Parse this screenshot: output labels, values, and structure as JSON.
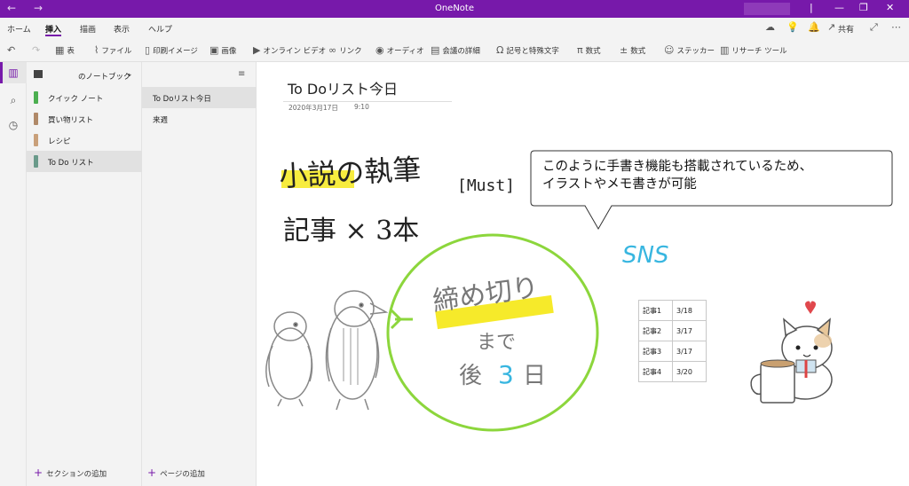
{
  "window": {
    "title": "OneNote",
    "back_icon": "arrow-left-icon",
    "forward_icon": "arrow-right-icon"
  },
  "menu": {
    "tabs": [
      "ホーム",
      "挿入",
      "描画",
      "表示",
      "ヘルプ"
    ],
    "active_tab": "挿入",
    "share_label": "共有"
  },
  "ribbon": {
    "items": [
      "表",
      "ファイル",
      "印刷イメージ",
      "画像",
      "オンライン ビデオ",
      "リンク",
      "オーディオ",
      "会議の詳細",
      "記号と特殊文字",
      "数式",
      "数式",
      "ステッカー",
      "リサーチ ツール"
    ]
  },
  "notebook": {
    "name": "のノートブック"
  },
  "sections": [
    {
      "label": "クイック ノート",
      "color": "#4caf50"
    },
    {
      "label": "買い物リスト",
      "color": "#b08968"
    },
    {
      "label": "レシピ",
      "color": "#c9a07a"
    },
    {
      "label": "To Do リスト",
      "color": "#6a9a8a"
    }
  ],
  "selected_section": "To Do リスト",
  "add_section_label": "セクションの追加",
  "pages": [
    {
      "label": "To Doリスト今日"
    },
    {
      "label": "来週"
    }
  ],
  "selected_page": "To Doリスト今日",
  "add_page_label": "ページの追加",
  "page": {
    "title": "To Doリスト今日",
    "date": "2020年3月17日",
    "time": "9:10"
  },
  "ink": {
    "line1": "小説の執筆",
    "tag": "[Must]",
    "line2": "記事 × 3本",
    "circle_line1": "締め切り",
    "circle_line2": "まで",
    "circle_line3_prefix": "後",
    "circle_line3_number": "3",
    "circle_line3_suffix": "日",
    "sns": "SNS"
  },
  "callout": {
    "text_line1": "このように手書き機能も搭載されているため、",
    "text_line2": "イラストやメモ書きが可能"
  },
  "table": {
    "rows": [
      [
        "記事1",
        "3/18"
      ],
      [
        "記事2",
        "3/17"
      ],
      [
        "記事3",
        "3/17"
      ],
      [
        "記事4",
        "3/20"
      ]
    ]
  },
  "colors": {
    "accent": "#7719aa",
    "highlight": "#f6ea2a",
    "green_ink": "#8cd63c",
    "blue_ink": "#38b6e0"
  }
}
